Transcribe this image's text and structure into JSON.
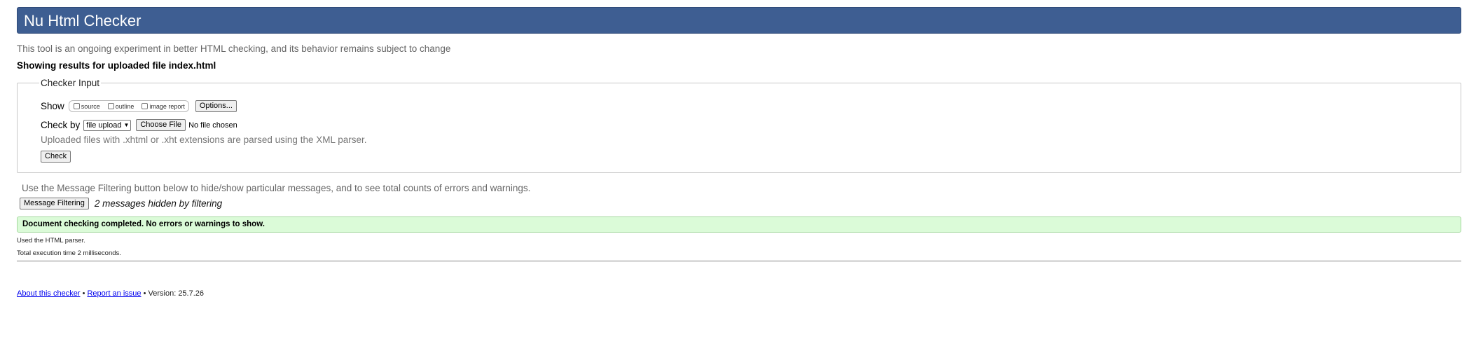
{
  "header": {
    "title": "Nu Html Checker"
  },
  "intro_text": "This tool is an ongoing experiment in better HTML checking, and its behavior remains subject to change",
  "results_for": "Showing results for uploaded file index.html",
  "checker_input": {
    "legend": "Checker Input",
    "show_label": "Show",
    "show_options": [
      {
        "label": "source",
        "checked": false
      },
      {
        "label": "outline",
        "checked": false
      },
      {
        "label": "image report",
        "checked": false
      }
    ],
    "options_button": "Options...",
    "check_by_label": "Check by",
    "check_by_selected": "file upload",
    "choose_file_button": "Choose File",
    "no_file_text": "No file chosen",
    "xml_note": "Uploaded files with .xhtml or .xht extensions are parsed using the XML parser.",
    "check_button": "Check"
  },
  "filtering": {
    "note": "Use the Message Filtering button below to hide/show particular messages, and to see total counts of errors and warnings.",
    "button": "Message Filtering",
    "hidden_count": "2 messages hidden by filtering"
  },
  "result": {
    "success": "Document checking completed. No errors or warnings to show.",
    "parser": "Used the HTML parser.",
    "execution": "Total execution time 2 milliseconds."
  },
  "footer": {
    "about_link": "About this checker",
    "separator": "•",
    "report_link": "Report an issue",
    "version": "Version: 25.7.26"
  },
  "colors": {
    "header_bg": "#3e5e92",
    "success_bg": "#dbfbd8",
    "link": "#0000ee"
  }
}
